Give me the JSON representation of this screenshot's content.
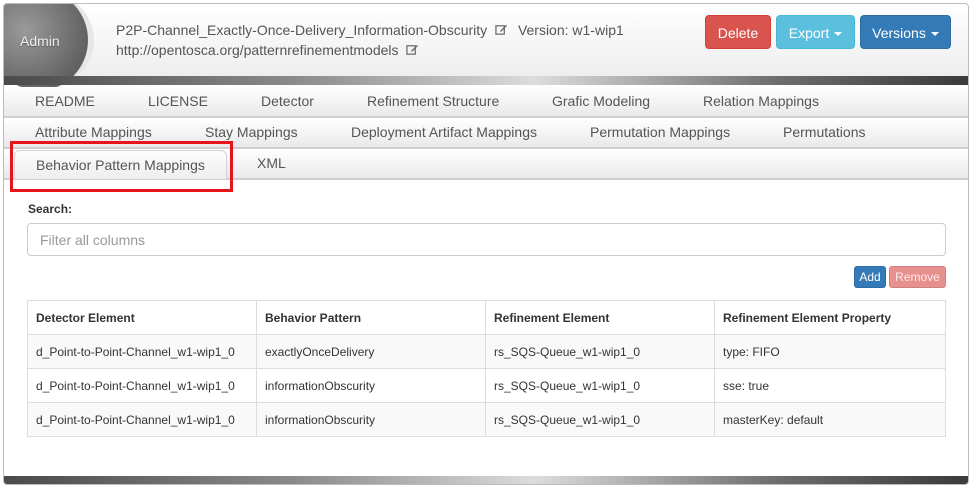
{
  "header": {
    "admin_label": "Admin",
    "title": "P2P-Channel_Exactly-Once-Delivery_Information-Obscurity",
    "version_text": "Version: w1-wip1",
    "namespace": "http://opentosca.org/patternrefinementmodels",
    "buttons": {
      "delete": "Delete",
      "export": "Export",
      "versions": "Versions"
    }
  },
  "tabs": {
    "row1": [
      "README",
      "LICENSE",
      "Detector",
      "Refinement Structure",
      "Grafic Modeling",
      "Relation Mappings"
    ],
    "row2": [
      "Attribute Mappings",
      "Stay Mappings",
      "Deployment Artifact Mappings",
      "Permutation Mappings",
      "Permutations"
    ],
    "row3": [
      "Behavior Pattern Mappings",
      "XML"
    ],
    "active": "Behavior Pattern Mappings"
  },
  "search": {
    "label": "Search:",
    "placeholder": "Filter all columns",
    "value": ""
  },
  "actions": {
    "add": "Add",
    "remove": "Remove"
  },
  "table": {
    "columns": [
      "Detector Element",
      "Behavior Pattern",
      "Refinement Element",
      "Refinement Element Property"
    ],
    "rows": [
      [
        "d_Point-to-Point-Channel_w1-wip1_0",
        "exactlyOnceDelivery",
        "rs_SQS-Queue_w1-wip1_0",
        "type: FIFO"
      ],
      [
        "d_Point-to-Point-Channel_w1-wip1_0",
        "informationObscurity",
        "rs_SQS-Queue_w1-wip1_0",
        "sse: true"
      ],
      [
        "d_Point-to-Point-Channel_w1-wip1_0",
        "informationObscurity",
        "rs_SQS-Queue_w1-wip1_0",
        "masterKey: default"
      ]
    ]
  },
  "colors": {
    "delete": "#d9534f",
    "export": "#5bc0de",
    "versions": "#337ab7",
    "add": "#337ab7",
    "remove": "#e7908e",
    "highlight": "#e8141b"
  }
}
